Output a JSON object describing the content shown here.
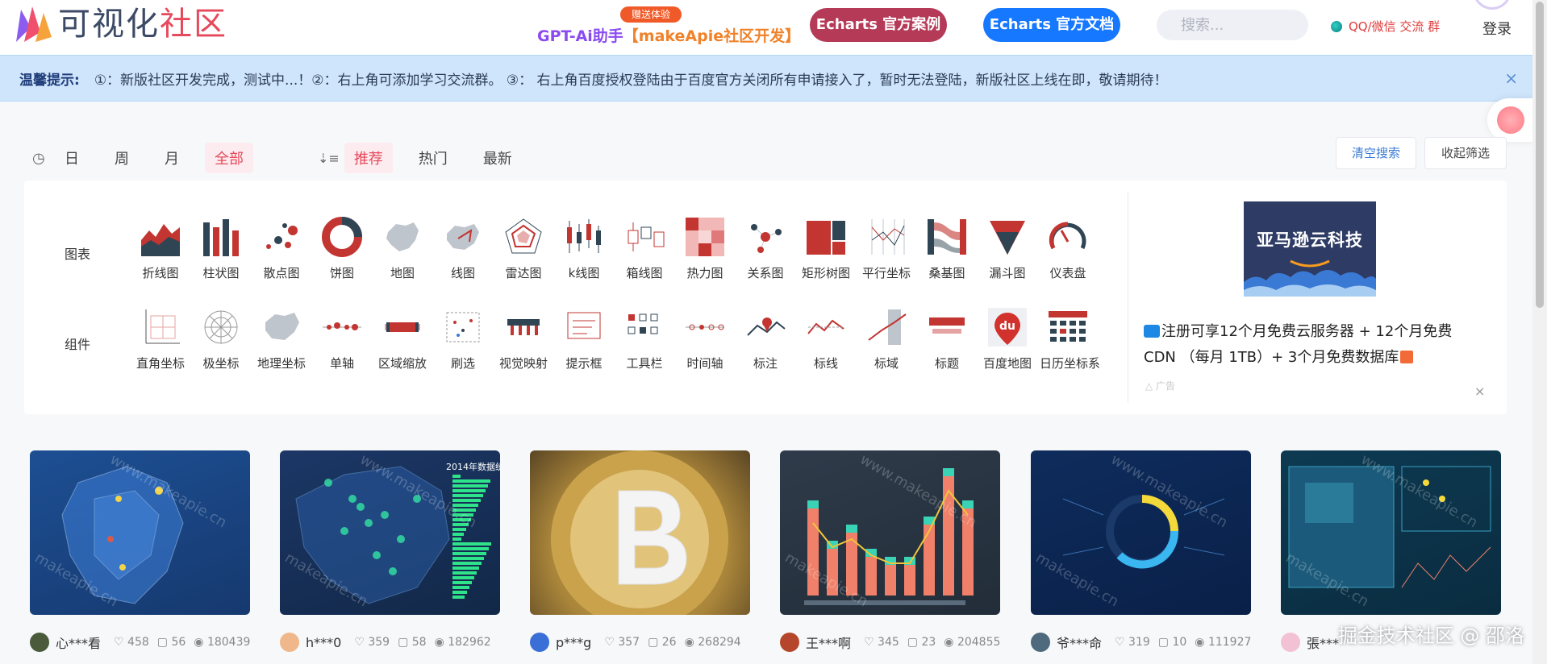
{
  "header": {
    "logo_text_1": "可视化",
    "logo_text_2": "社区",
    "gpt_badge": "赠送体验",
    "gpt_text_1": "GPT-Ai助手",
    "gpt_text_2": "【makeApie社区开发】",
    "btn_case": "Echarts 官方案例",
    "btn_doc": "Echarts 官方文档",
    "search_placeholder": "搜索...",
    "qq": "QQ/微信 交流 群",
    "login": "登录"
  },
  "notice": {
    "title": "温馨提示:",
    "text": "①：新版社区开发完成，测试中...！②：右上角可添加学习交流群。 ③： 右上角百度授权登陆由于百度官方关闭所有申请接入了，暂时无法登陆，新版社区上线在即，敬请期待！",
    "close": "×"
  },
  "filter": {
    "time_icon": "clock-icon",
    "time": [
      "日",
      "周",
      "月",
      "全部"
    ],
    "time_active": "全部",
    "sort_icon": "sort-icon",
    "sort": [
      "推荐",
      "热门",
      "最新"
    ],
    "sort_active": "推荐",
    "clear": "清空搜索",
    "fold": "收起筛选"
  },
  "categories": {
    "chart_label": "图表",
    "chart_items": [
      "折线图",
      "柱状图",
      "散点图",
      "饼图",
      "地图",
      "线图",
      "雷达图",
      "k线图",
      "箱线图",
      "热力图",
      "关系图",
      "矩形树图",
      "平行坐标",
      "桑基图",
      "漏斗图",
      "仪表盘"
    ],
    "component_label": "组件",
    "component_items": [
      "直角坐标",
      "极坐标",
      "地理坐标",
      "单轴",
      "区域缩放",
      "刷选",
      "视觉映射",
      "提示框",
      "工具栏",
      "时间轴",
      "标注",
      "标线",
      "标域",
      "标题",
      "百度地图",
      "日历坐标系"
    ]
  },
  "ad": {
    "logo_text": "亚马逊云科技",
    "text": "注册可享12个月免费云服务器 + 12个月免费CDN （每月 1TB）+ 3个月免费数据库",
    "tag": "广告",
    "close": "×"
  },
  "cards": [
    {
      "user": "心***看",
      "likes": "458",
      "comments": "56",
      "views": "180439"
    },
    {
      "user": "h***0",
      "likes": "359",
      "comments": "58",
      "views": "182962"
    },
    {
      "user": "p***g",
      "likes": "357",
      "comments": "26",
      "views": "268294"
    },
    {
      "user": "王***啊",
      "likes": "345",
      "comments": "23",
      "views": "204855"
    },
    {
      "user": "爷***命",
      "likes": "319",
      "comments": "10",
      "views": "111927"
    },
    {
      "user": "張***",
      "likes": "",
      "comments": "",
      "views": ""
    }
  ],
  "thumb_texts": {
    "card2_title": "2014年数据统",
    "watermark_site": "www.makeapie.cn",
    "watermark_short": "makeapie.cn"
  },
  "footer_watermark": "掘金技术社区 @ 邵洛",
  "colors": {
    "accent": "#e6495c",
    "brand_blue": "#1677ff",
    "case_red": "#b53a58",
    "notice_bg": "#cfe5fb"
  }
}
